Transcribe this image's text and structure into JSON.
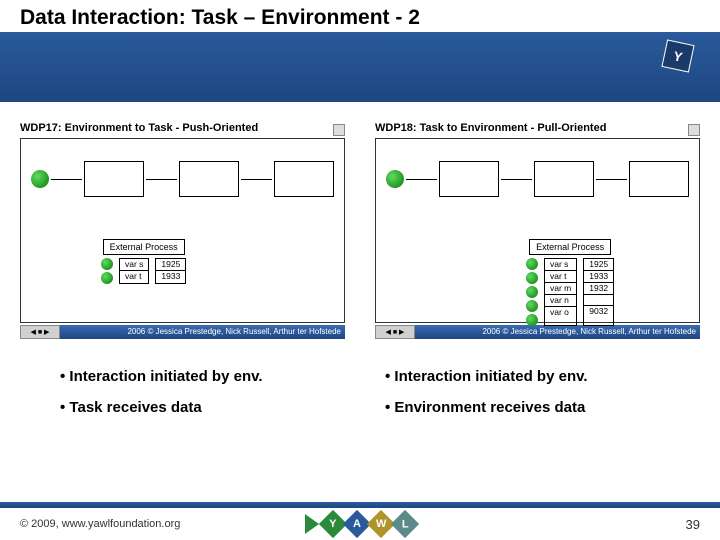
{
  "title": "Data Interaction: Task – Environment - 2",
  "panels": [
    {
      "heading": "WDP17: Environment to Task - Push-Oriented",
      "external_label": "External Process",
      "vars": [
        "var s",
        "var t"
      ],
      "vals": [
        "1925",
        "1933"
      ],
      "credit": "2006 © Jessica Prestedge, Nick Russell, Arthur ter Hofstede"
    },
    {
      "heading": "WDP18: Task to Environment - Pull-Oriented",
      "external_label": "External Process",
      "vars": [
        "var s",
        "var t",
        "var m",
        "var n",
        "var o"
      ],
      "vals": [
        "1925",
        "1933",
        "1932",
        "",
        "9032"
      ],
      "credit": "2006 © Jessica Prestedge, Nick Russell, Arthur ter Hofstede"
    }
  ],
  "bullets_left": [
    "Interaction initiated by env.",
    "Task receives data"
  ],
  "bullets_right": [
    "Interaction initiated by env.",
    "Environment receives data"
  ],
  "copyright": "© 2009, www.yawlfoundation.org",
  "page": "39",
  "yawl": [
    "Y",
    "A",
    "W",
    "L"
  ]
}
